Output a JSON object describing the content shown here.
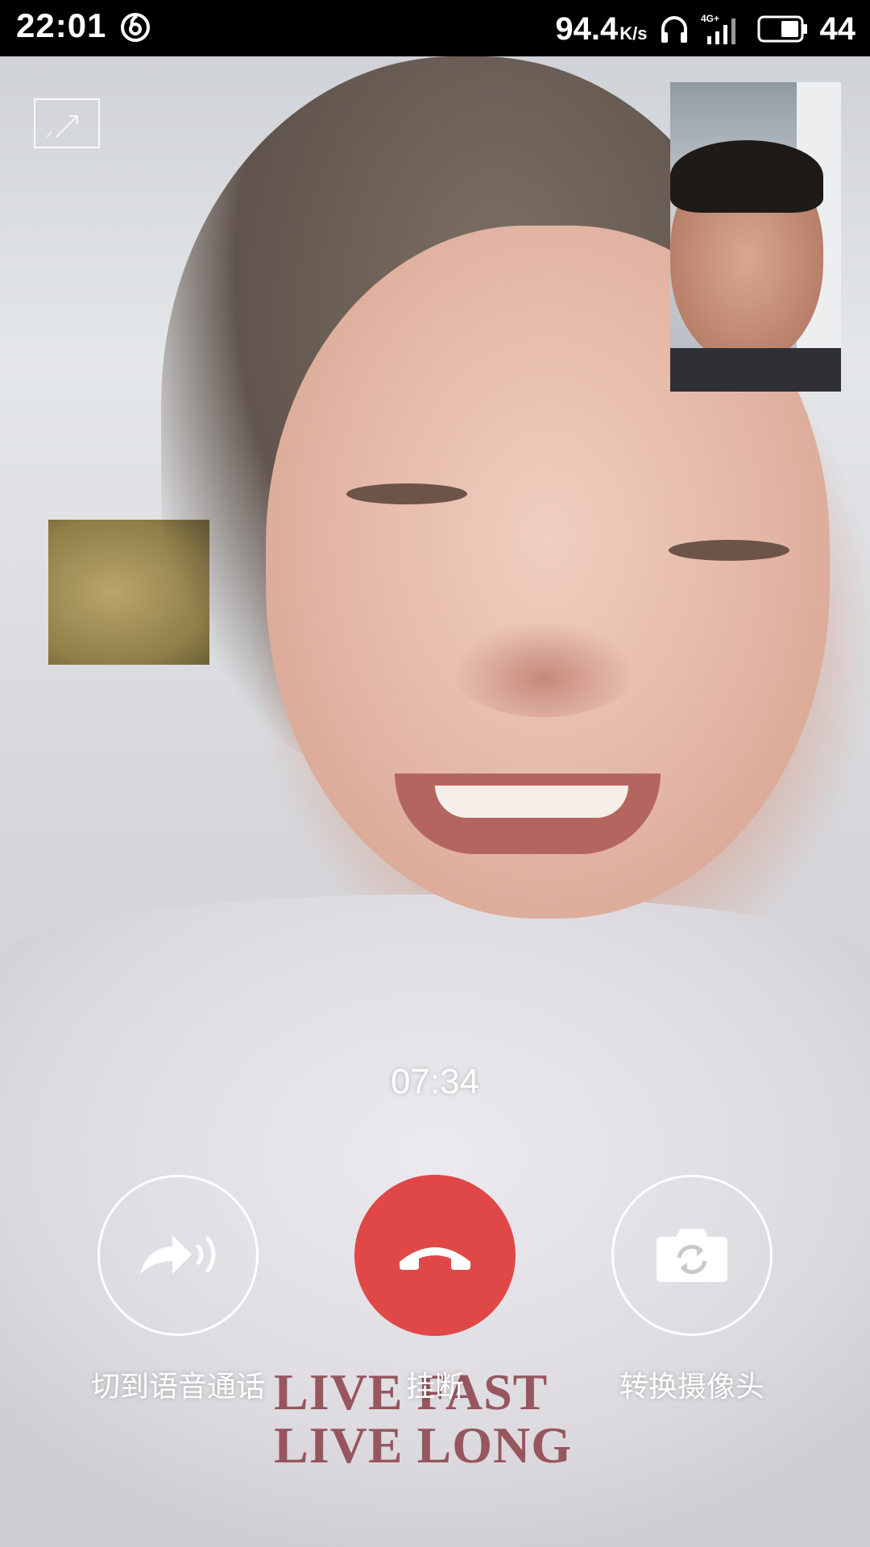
{
  "status_bar": {
    "time": "22:01",
    "net_speed": "94.4",
    "net_unit": "K/s",
    "network_type": "4G+",
    "battery_level": "44",
    "icons": [
      "netease-music-icon",
      "headphones-icon",
      "signal-4g-icon",
      "battery-icon"
    ]
  },
  "call": {
    "duration": "07:34",
    "background_text": [
      "LIVE FAST",
      "LIVE LONG"
    ]
  },
  "controls": {
    "switch_voice_label": "切到语音通话",
    "hangup_label": "挂断",
    "switch_camera_label": "转换摄像头"
  },
  "colors": {
    "hangup": "#e04848",
    "status_bar_bg": "#000000",
    "control_text": "#ffffff"
  }
}
